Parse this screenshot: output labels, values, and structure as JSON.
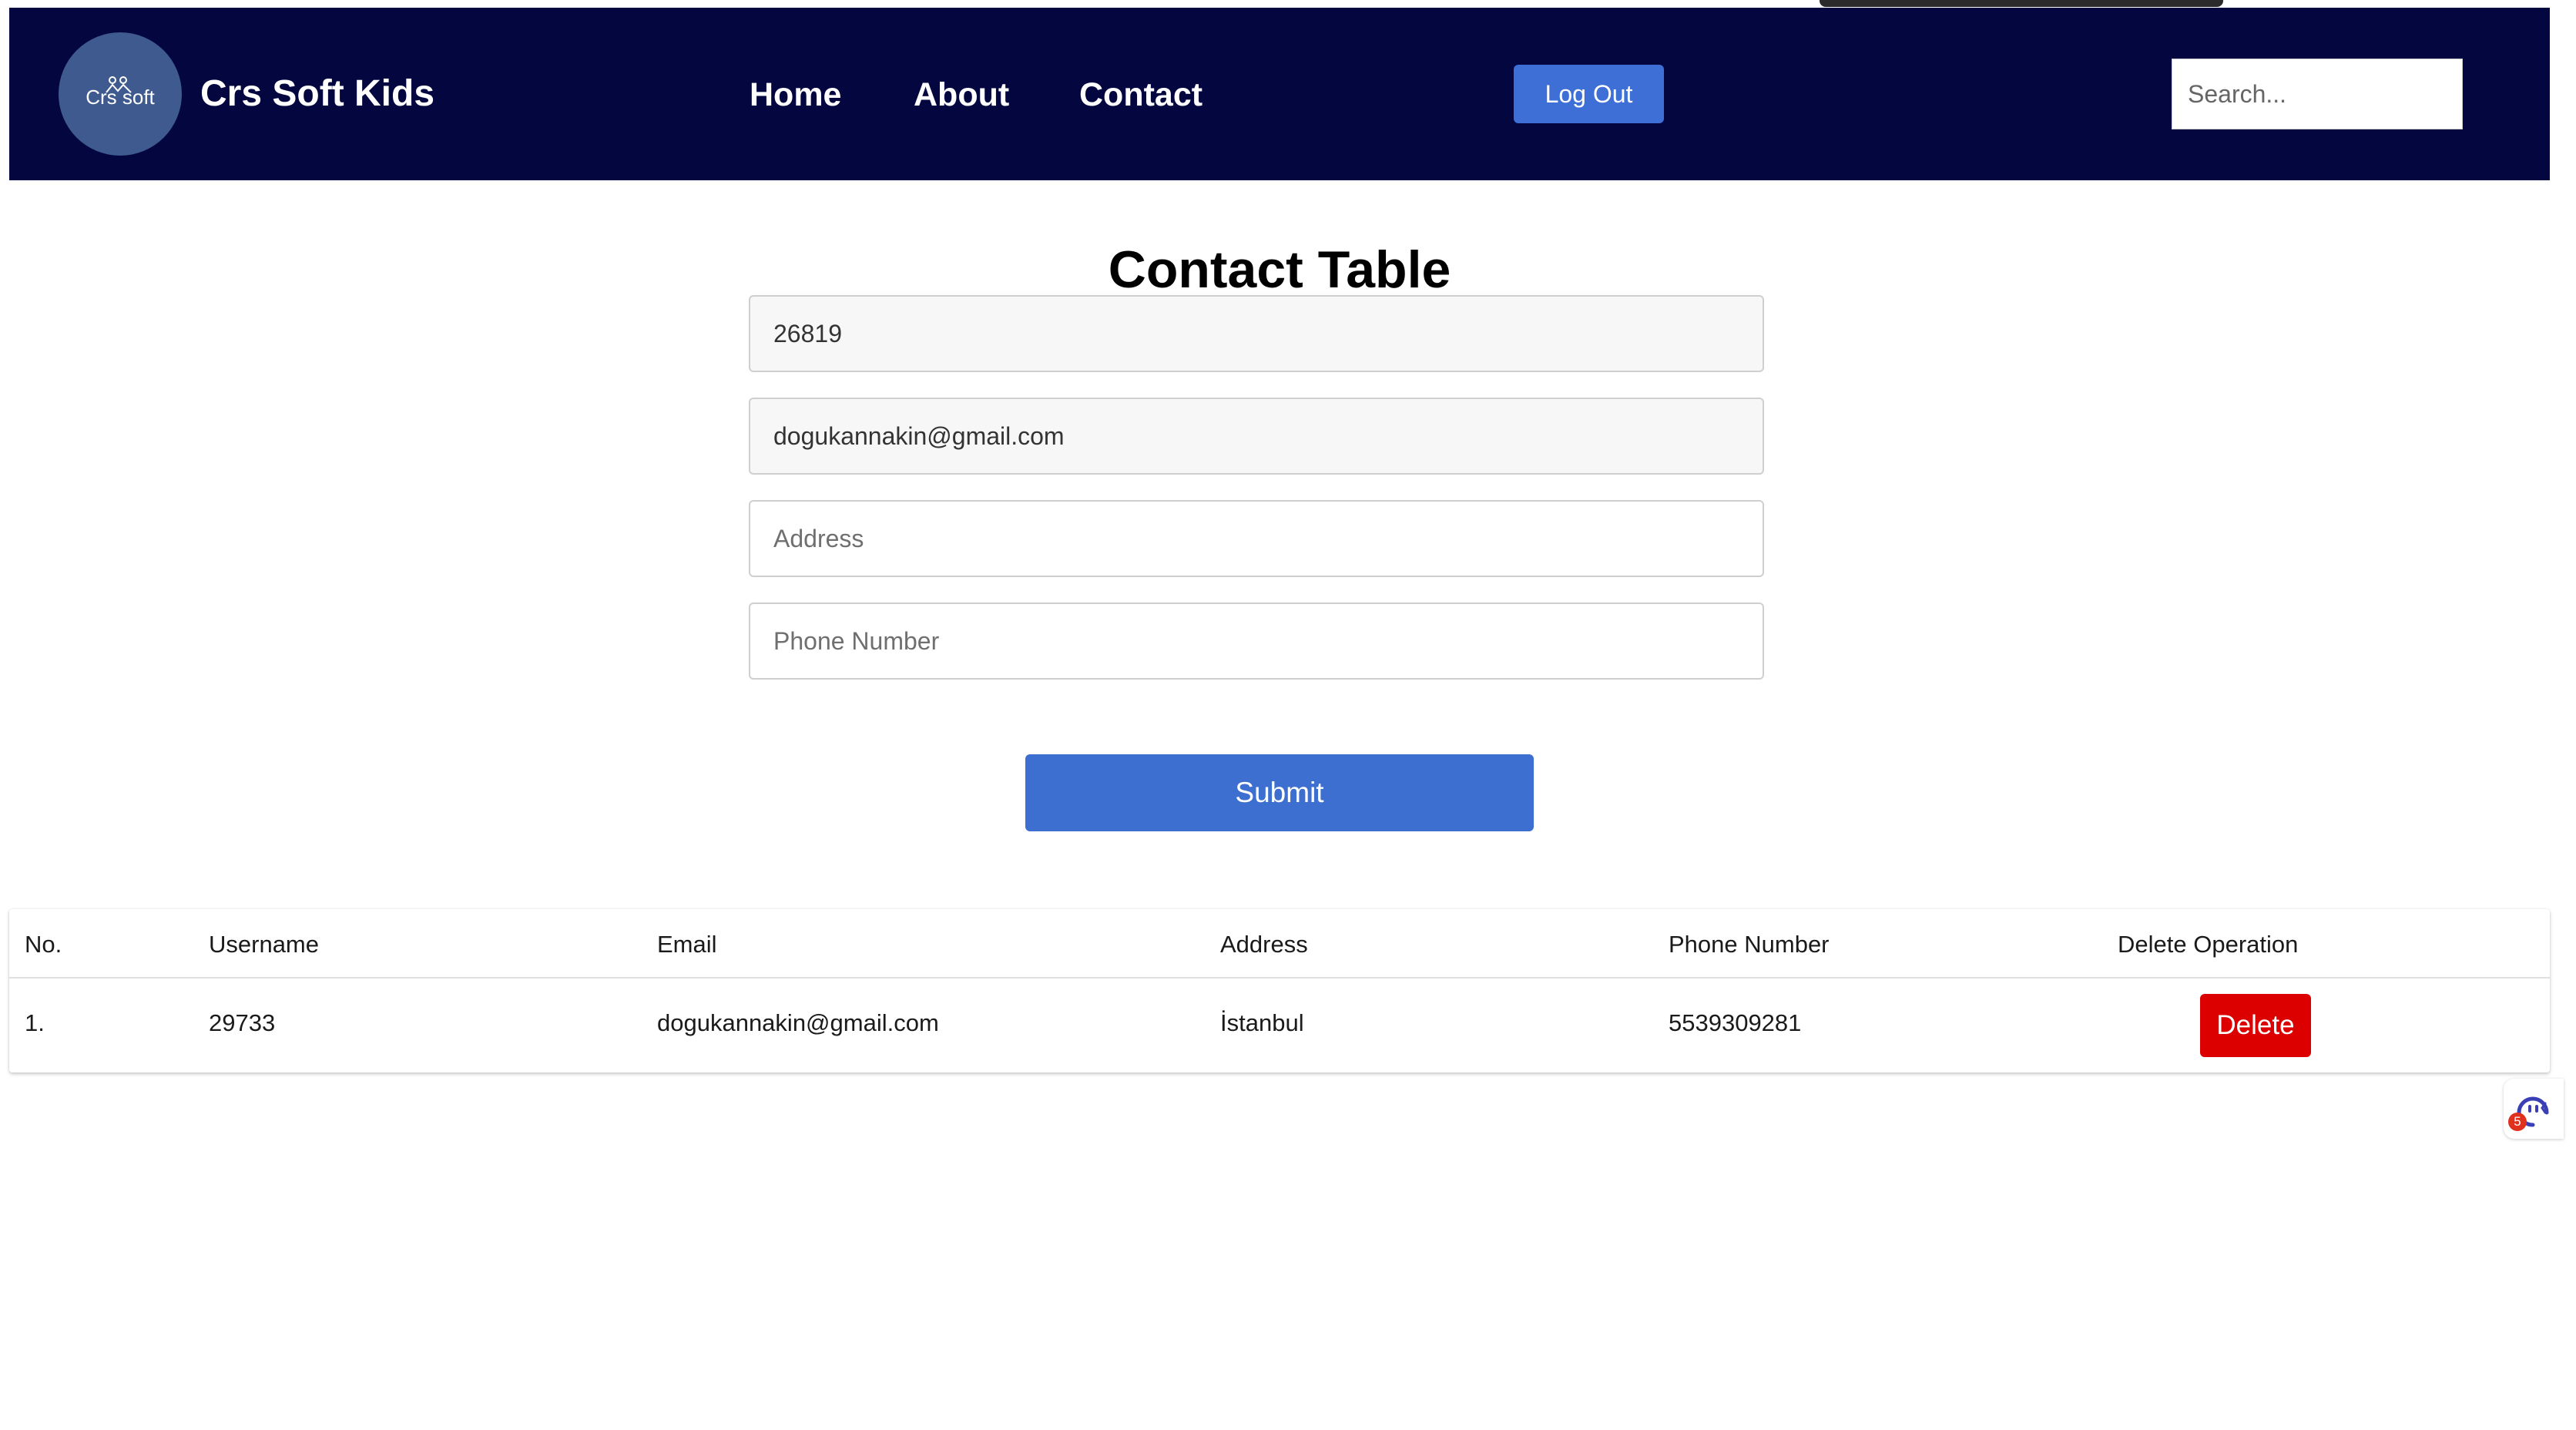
{
  "header": {
    "logo_text": "Crs soft",
    "brand": "Crs Soft Kids",
    "nav": {
      "home": "Home",
      "about": "About",
      "contact": "Contact"
    },
    "logout_label": "Log Out",
    "search_placeholder": "Search..."
  },
  "main": {
    "title": "Contact Table",
    "form": {
      "username_value": "26819",
      "email_value": "dogukannakin@gmail.com",
      "address_placeholder": "Address",
      "phone_placeholder": "Phone Number",
      "submit_label": "Submit"
    }
  },
  "table": {
    "headers": {
      "no": "No.",
      "username": "Username",
      "email": "Email",
      "address": "Address",
      "phone": "Phone Number",
      "delete": "Delete Operation"
    },
    "rows": [
      {
        "no": "1.",
        "username": "29733",
        "email": "dogukannakin@gmail.com",
        "address": "İstanbul",
        "phone": "5539309281",
        "delete_label": "Delete"
      }
    ]
  },
  "widget": {
    "icon": "support-headset-icon",
    "badge": "5"
  },
  "colors": {
    "navbar": "#03063f",
    "primary_button": "#3d6fd6",
    "delete_button": "#dc0000"
  }
}
